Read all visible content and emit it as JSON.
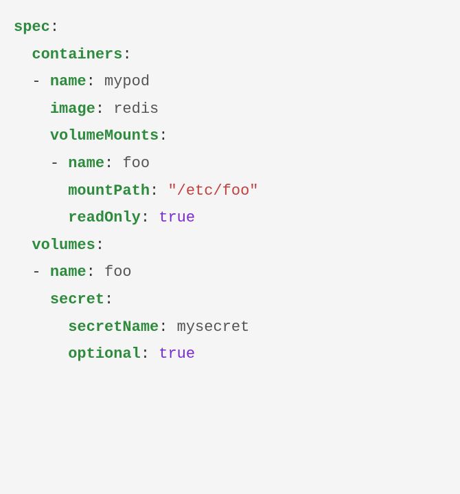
{
  "lines": {
    "l0": {
      "key": "spec",
      "colon": ":"
    },
    "l1": {
      "key": "containers",
      "colon": ":"
    },
    "l2": {
      "dash": "- ",
      "key": "name",
      "colon": ": ",
      "value": "mypod"
    },
    "l3": {
      "key": "image",
      "colon": ": ",
      "value": "redis"
    },
    "l4": {
      "key": "volumeMounts",
      "colon": ":"
    },
    "l5": {
      "dash": "- ",
      "key": "name",
      "colon": ": ",
      "value": "foo"
    },
    "l6": {
      "key": "mountPath",
      "colon": ": ",
      "string": "\"/etc/foo\""
    },
    "l7": {
      "key": "readOnly",
      "colon": ": ",
      "bool": "true"
    },
    "l8": {
      "key": "volumes",
      "colon": ":"
    },
    "l9": {
      "dash": "- ",
      "key": "name",
      "colon": ": ",
      "value": "foo"
    },
    "l10": {
      "key": "secret",
      "colon": ":"
    },
    "l11": {
      "key": "secretName",
      "colon": ": ",
      "value": "mysecret"
    },
    "l12": {
      "key": "optional",
      "colon": ": ",
      "bool": "true"
    }
  }
}
